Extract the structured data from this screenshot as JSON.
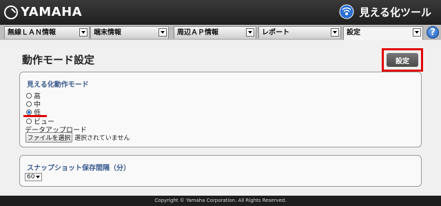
{
  "header": {
    "logo_text": "YAMAHA",
    "app_name": "見える化ツール"
  },
  "tabs": [
    {
      "label": "無線ＬＡＮ情報",
      "active": false
    },
    {
      "label": "端末情報",
      "active": false
    },
    {
      "label": "周辺ＡＰ情報",
      "active": false
    },
    {
      "label": "レポート",
      "active": false
    },
    {
      "label": "設定",
      "active": true
    }
  ],
  "help_label": "?",
  "page": {
    "title": "動作モード設定",
    "settings_button": "設定"
  },
  "mode_panel": {
    "title": "見える化動作モード",
    "options": [
      {
        "label": "高",
        "checked": false
      },
      {
        "label": "中",
        "checked": false
      },
      {
        "label": "低",
        "checked": true
      },
      {
        "label": "ビュー",
        "checked": false
      }
    ],
    "upload_label": "データアップロード",
    "file_button": "ファイルを選択",
    "file_status": "選択されていません"
  },
  "snapshot_panel": {
    "title": "スナップショット保存間隔（分）",
    "interval_value": "60"
  },
  "footer": {
    "copyright": "Copyright © Yamaha Corporation. All Rights Reserved."
  },
  "colors": {
    "highlight": "#e00000",
    "panel_title": "#3a5a8f",
    "header_bg": "#2a2a2a"
  }
}
